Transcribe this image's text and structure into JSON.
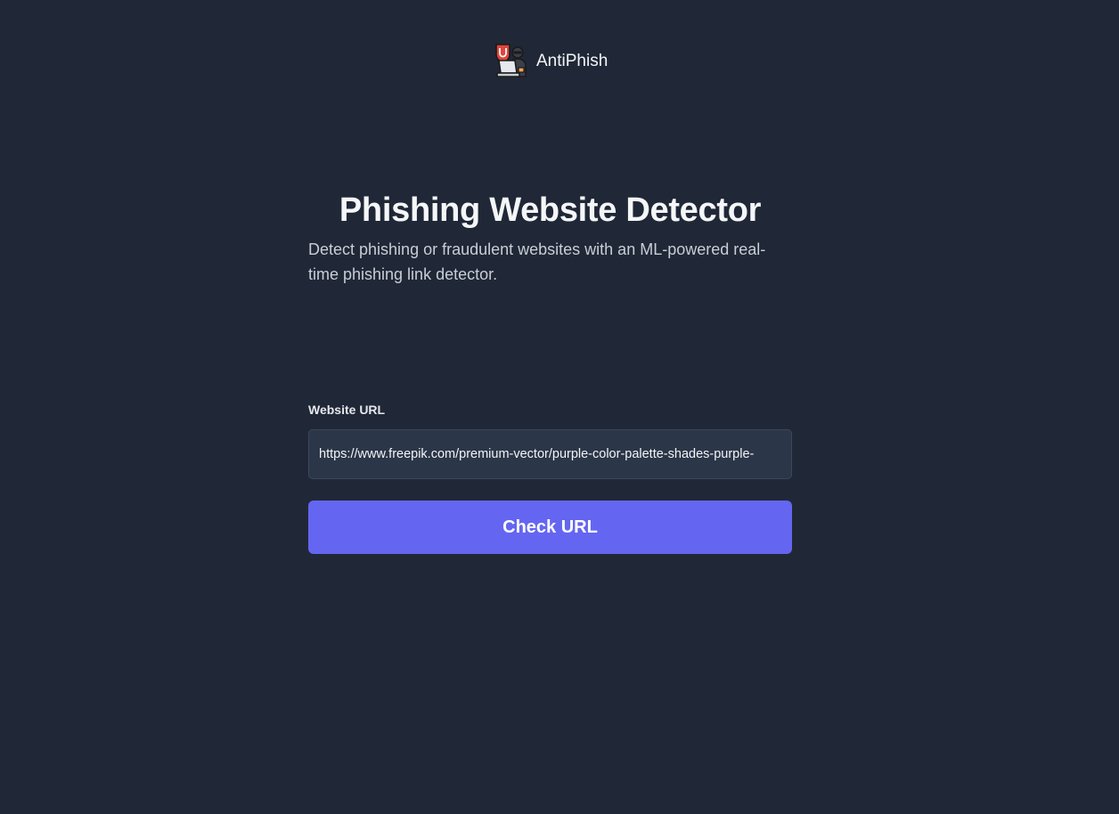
{
  "header": {
    "brand_name": "AntiPhish",
    "logo_icon": "hacker-laptop-shield-icon"
  },
  "hero": {
    "title": "Phishing Website Detector",
    "subtitle": "Detect phishing or fraudulent websites with an ML-powered real-time phishing link detector."
  },
  "form": {
    "url_label": "Website URL",
    "url_value": "https://www.freepik.com/premium-vector/purple-color-palette-shades-purple-",
    "submit_label": "Check URL"
  },
  "colors": {
    "background": "#202837",
    "input_background": "#2b3648",
    "accent": "#6466f1",
    "text": "#f3f4f6"
  }
}
